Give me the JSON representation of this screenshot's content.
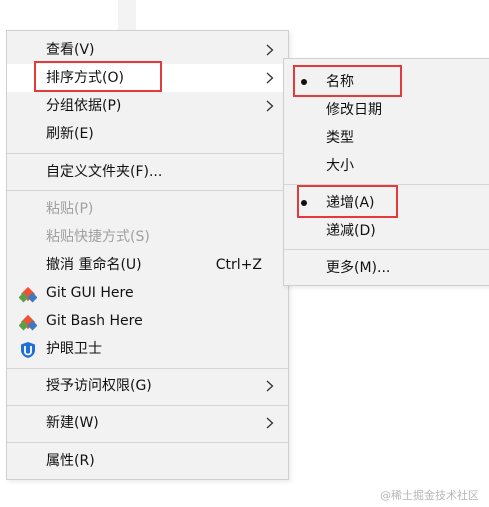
{
  "main_menu": {
    "items": [
      {
        "label": "查看(V)",
        "has_submenu": true
      },
      {
        "label": "排序方式(O)",
        "has_submenu": true
      },
      {
        "label": "分组依据(P)",
        "has_submenu": true
      },
      {
        "label": "刷新(E)"
      },
      {
        "label": "自定义文件夹(F)..."
      },
      {
        "label": "粘贴(P)",
        "disabled": true
      },
      {
        "label": "粘贴快捷方式(S)",
        "disabled": true
      },
      {
        "label": "撤消 重命名(U)",
        "shortcut": "Ctrl+Z"
      },
      {
        "label": "Git GUI Here",
        "icon": "git-gui-icon"
      },
      {
        "label": "Git Bash Here",
        "icon": "git-bash-icon"
      },
      {
        "label": "护眼卫士",
        "icon": "eye-guard-shield-icon"
      },
      {
        "label": "授予访问权限(G)",
        "has_submenu": true
      },
      {
        "label": "新建(W)",
        "has_submenu": true
      },
      {
        "label": "属性(R)"
      }
    ]
  },
  "sort_submenu": {
    "items": [
      {
        "label": "名称",
        "selected": true
      },
      {
        "label": "修改日期"
      },
      {
        "label": "类型"
      },
      {
        "label": "大小"
      },
      {
        "label": "递增(A)",
        "selected": true
      },
      {
        "label": "递减(D)"
      },
      {
        "label": "更多(M)..."
      }
    ]
  },
  "colors": {
    "menu_bg": "#f2f2f2",
    "hover_bg": "#ffffff",
    "disabled_text": "#a0a0a0",
    "annotation_red": "#e23b3b",
    "git_red": "#f05133",
    "git_green": "#5aa04b",
    "git_blue": "#3b79c4",
    "shield_blue": "#1f6fd8"
  },
  "watermark": "@稀土掘金技术社区"
}
